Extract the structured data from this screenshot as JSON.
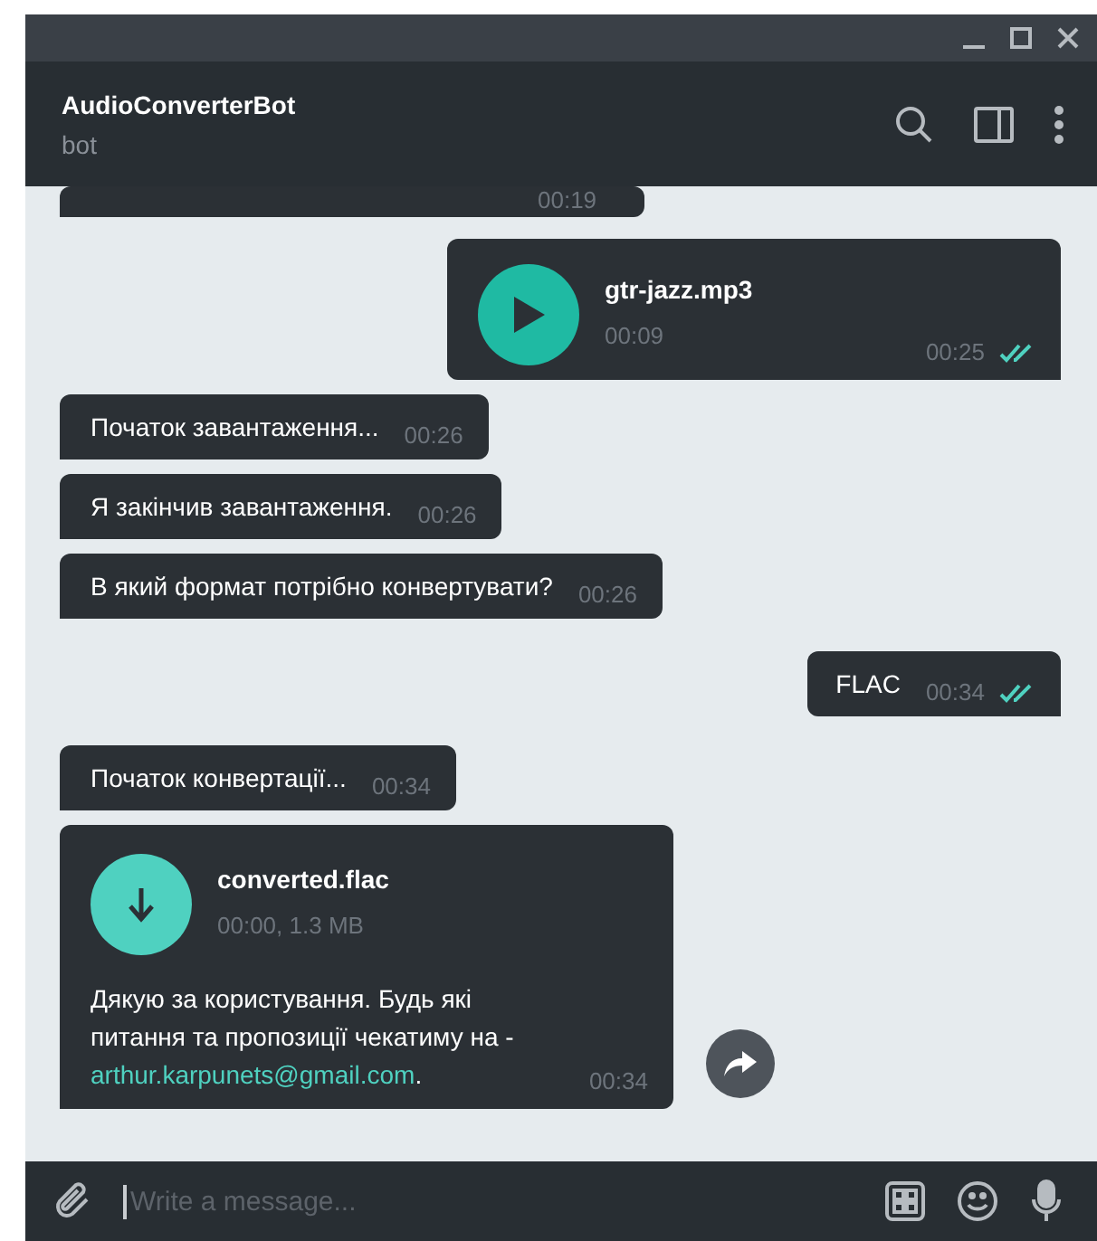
{
  "window": {
    "title": "AudioConverterBot",
    "subtitle": "bot"
  },
  "messages": [
    {
      "kind": "partial",
      "outgoing": false,
      "time": "00:19"
    },
    {
      "kind": "audio",
      "outgoing": true,
      "name": "gtr-jazz.mp3",
      "duration": "00:09",
      "time": "00:25",
      "read": true
    },
    {
      "kind": "text",
      "outgoing": false,
      "text": "Початок завантаження...",
      "time": "00:26"
    },
    {
      "kind": "text",
      "outgoing": false,
      "text": "Я закінчив завантаження.",
      "time": "00:26"
    },
    {
      "kind": "text",
      "outgoing": false,
      "text": "В який формат потрібно конвертувати?",
      "time": "00:26"
    },
    {
      "kind": "text",
      "outgoing": true,
      "text": "FLAC",
      "time": "00:34",
      "read": true
    },
    {
      "kind": "text",
      "outgoing": false,
      "text": "Початок конвертації...",
      "time": "00:34"
    },
    {
      "kind": "file",
      "outgoing": false,
      "name": "converted.flac",
      "info": "00:00, 1.3 MB",
      "caption": "Дякую за користування. Будь які питання та пропозиції чекатиму на -",
      "link": "arthur.karpunets@gmail.com",
      "after": ".",
      "time": "00:34"
    }
  ],
  "composer": {
    "placeholder": "Write a message..."
  }
}
